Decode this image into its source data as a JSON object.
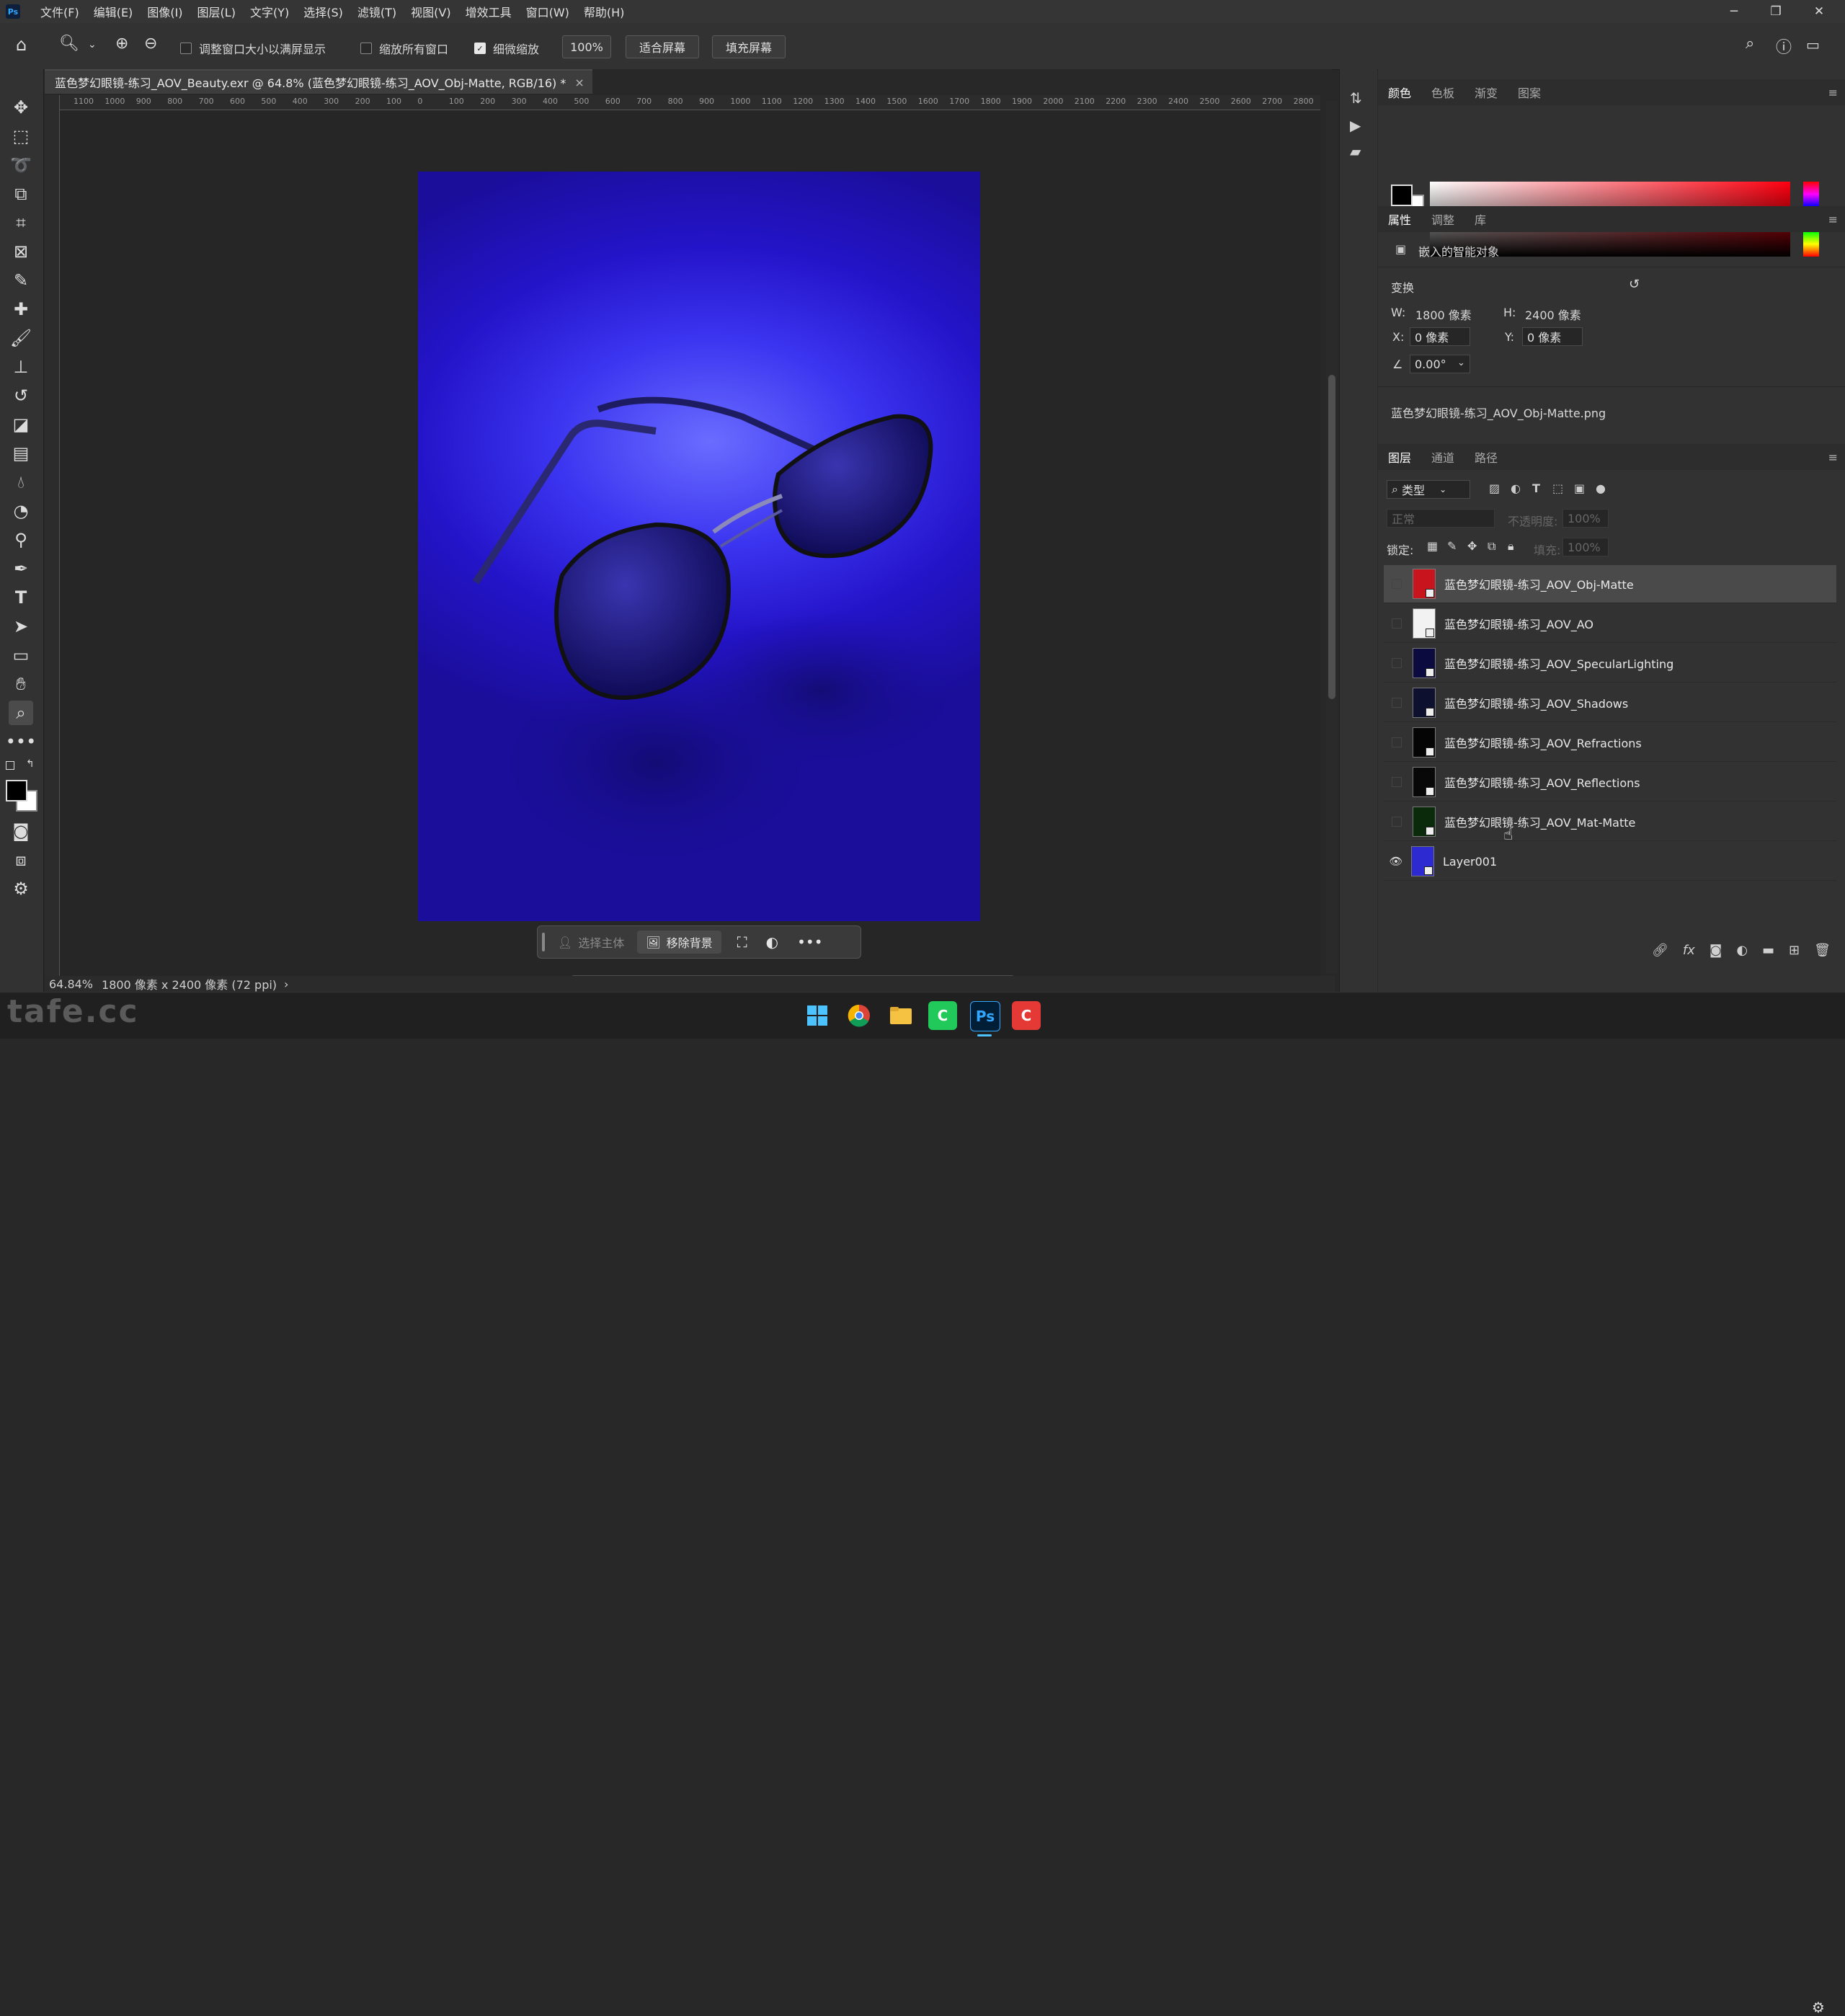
{
  "menubar": {
    "items": [
      "文件(F)",
      "编辑(E)",
      "图像(I)",
      "图层(L)",
      "文字(Y)",
      "选择(S)",
      "滤镜(T)",
      "视图(V)",
      "增效工具",
      "窗口(W)",
      "帮助(H)"
    ],
    "minimize": "─",
    "restore": "❐",
    "close": "✕"
  },
  "options": {
    "chk_resize": "调整窗口大小以满屏显示",
    "chk_zoom_all": "缩放所有窗口",
    "chk_scrubby": "细微缩放",
    "zoom_value": "100%",
    "fit_screen": "适合屏幕",
    "fill_screen": "填充屏幕"
  },
  "document": {
    "tab_title": "蓝色梦幻眼镜-练习_AOV_Beauty.exr @ 64.8% (蓝色梦幻眼镜-练习_AOV_Obj-Matte, RGB/16) *",
    "close": "×"
  },
  "ruler": {
    "h_ticks": [
      "1100",
      "1000",
      "900",
      "800",
      "700",
      "600",
      "500",
      "400",
      "300",
      "200",
      "100",
      "0",
      "100",
      "200",
      "300",
      "400",
      "500",
      "600",
      "700",
      "800",
      "900",
      "1000",
      "1100",
      "1200",
      "1300",
      "1400",
      "1500",
      "1600",
      "1700",
      "1800",
      "1900",
      "2000",
      "2100",
      "2200",
      "2300",
      "2400",
      "2500",
      "2600",
      "2700",
      "2800"
    ]
  },
  "context_bar": {
    "select_subject": "选择主体",
    "remove_bg": "移除背景"
  },
  "status": {
    "zoom": "64.84%",
    "doc_info": "1800 像素 x 2400 像素 (72 ppi)"
  },
  "color_panel": {
    "tabs": [
      "颜色",
      "色板",
      "渐变",
      "图案"
    ]
  },
  "properties": {
    "tabs": [
      "属性",
      "调整",
      "库"
    ],
    "object_type": "嵌入的智能对象",
    "transform_label": "变换",
    "w_label": "W:",
    "w_value": "1800 像素",
    "h_label": "H:",
    "h_value": "2400 像素",
    "x_label": "X:",
    "x_value": "0 像素",
    "y_label": "Y:",
    "y_value": "0 像素",
    "angle_value": "0.00°",
    "linked_file": "蓝色梦幻眼镜-练习_AOV_Obj-Matte.png"
  },
  "layers": {
    "tabs": [
      "图层",
      "通道",
      "路径"
    ],
    "filter_label": "类型",
    "blend_mode": "正常",
    "opacity_label": "不透明度:",
    "opacity_value": "100%",
    "lock_label": "锁定:",
    "fill_label": "填充:",
    "fill_value": "100%",
    "items": [
      {
        "name": "蓝色梦幻眼镜-练习_AOV_Obj-Matte",
        "visible": false,
        "selected": true,
        "thumb": "#c8141c"
      },
      {
        "name": "蓝色梦幻眼镜-练习_AOV_AO",
        "visible": false,
        "selected": false,
        "thumb": "#f2f2f2"
      },
      {
        "name": "蓝色梦幻眼镜-练习_AOV_SpecularLighting",
        "visible": false,
        "selected": false,
        "thumb": "#0b0b40"
      },
      {
        "name": "蓝色梦幻眼镜-练习_AOV_Shadows",
        "visible": false,
        "selected": false,
        "thumb": "#0e1030"
      },
      {
        "name": "蓝色梦幻眼镜-练习_AOV_Refractions",
        "visible": false,
        "selected": false,
        "thumb": "#050505"
      },
      {
        "name": "蓝色梦幻眼镜-练习_AOV_Reflections",
        "visible": false,
        "selected": false,
        "thumb": "#080808"
      },
      {
        "name": "蓝色梦幻眼镜-练习_AOV_Mat-Matte",
        "visible": false,
        "selected": false,
        "thumb": "#0b2a0b"
      },
      {
        "name": "Layer001",
        "visible": true,
        "selected": false,
        "thumb": "#2c2ad0"
      }
    ]
  },
  "taskbar": {
    "photoshop_label": "Ps"
  },
  "watermark": "tafe.cc",
  "colors": {
    "image_blue": "#2a1fd8",
    "selected_layer": "#4a4a4a"
  }
}
